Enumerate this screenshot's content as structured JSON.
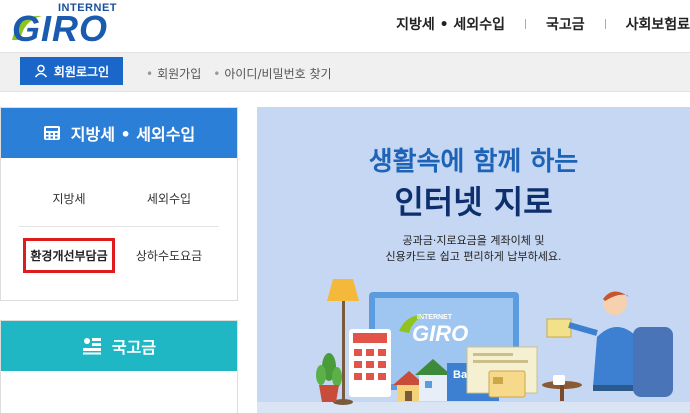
{
  "header": {
    "logo_small": "INTERNET",
    "logo_big": "GIRO",
    "nav": [
      "지방세 • 세외수입",
      "국고금",
      "사회보험료"
    ]
  },
  "loginbar": {
    "login_label": "회원로그인",
    "links": [
      "회원가입",
      "아이디/비밀번호 찾기"
    ]
  },
  "left": {
    "box1_title": "지방세 • 세외수입",
    "items": [
      "지방세",
      "세외수입",
      "환경개선부담금",
      "상하수도요금"
    ],
    "box2_title": "국고금"
  },
  "banner": {
    "title1": "생활속에 함께 하는",
    "title2": "인터넷 지로",
    "sub1": "공과금·지로요금을 계좌이체 및",
    "sub2": "신용카드로 쉽고 편리하게 납부하세요.",
    "screen_logo": "GIRO",
    "bank_label": "Bank"
  },
  "colors": {
    "brand_blue": "#1b66c9",
    "box1_head": "#2c7fd6",
    "box2_head": "#1fb7c4",
    "highlight": "#e01b1b",
    "banner_bg": "#c5d7f2"
  }
}
